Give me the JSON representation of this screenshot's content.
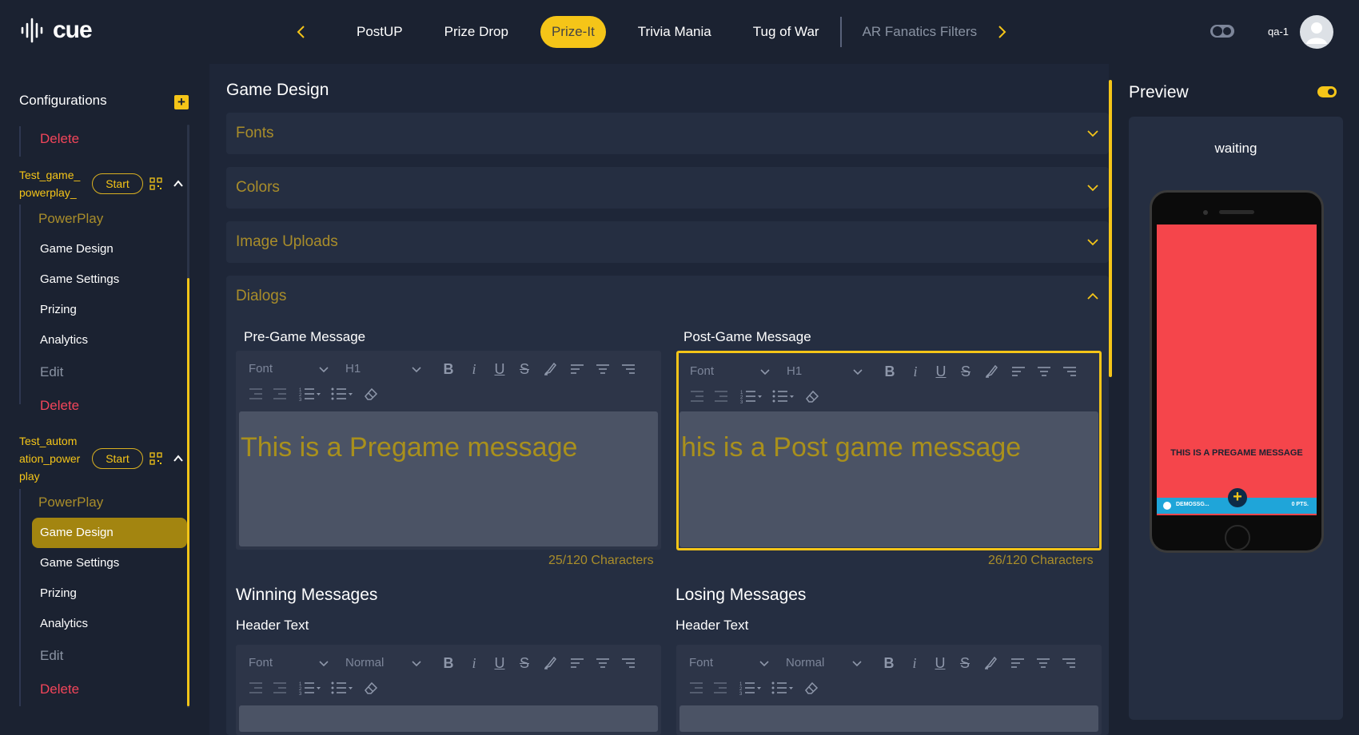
{
  "brand": {
    "name": "cue"
  },
  "top_tabs": [
    {
      "label": "PostUP",
      "active": false
    },
    {
      "label": "Prize Drop",
      "active": false
    },
    {
      "label": "Prize-It",
      "active": true
    },
    {
      "label": "Trivia Mania",
      "active": false
    },
    {
      "label": "Tug of War",
      "active": false
    },
    {
      "label": "AR Fanatics Filters",
      "active": false
    }
  ],
  "user": {
    "name": "qa-1"
  },
  "sidebar": {
    "title": "Configurations",
    "top_delete": "Delete",
    "configs": [
      {
        "name_lines": [
          "Test_game_",
          "powerplay_"
        ],
        "start_label": "Start",
        "type": "PowerPlay",
        "items": [
          "Game Design",
          "Game Settings",
          "Prizing",
          "Analytics"
        ],
        "edit": "Edit",
        "delete": "Delete"
      },
      {
        "name_lines": [
          "Test_autom",
          "ation_power",
          "play"
        ],
        "start_label": "Start",
        "type": "PowerPlay",
        "items": [
          "Game Design",
          "Game Settings",
          "Prizing",
          "Analytics"
        ],
        "edit": "Edit",
        "delete": "Delete",
        "selected_item": "Game Design"
      }
    ]
  },
  "main": {
    "title": "Game Design",
    "accordions": [
      {
        "label": "Fonts",
        "expanded": false
      },
      {
        "label": "Colors",
        "expanded": false
      },
      {
        "label": "Image Uploads",
        "expanded": false
      },
      {
        "label": "Dialogs",
        "expanded": true
      }
    ],
    "dialogs": {
      "pre_game": {
        "label": "Pre-Game Message",
        "font_placeholder": "Font",
        "heading": "H1",
        "content": "This is a Pregame message",
        "count": "25/120 Characters"
      },
      "post_game": {
        "label": "Post-Game Message",
        "font_placeholder": "Font",
        "heading": "H1",
        "content": "his is a Post game message",
        "count": "26/120 Characters"
      },
      "winning": {
        "title": "Winning Messages",
        "header_label": "Header Text",
        "font_placeholder": "Font",
        "heading": "Normal"
      },
      "losing": {
        "title": "Losing Messages",
        "header_label": "Header Text",
        "font_placeholder": "Font",
        "heading": "Normal"
      }
    }
  },
  "preview": {
    "title": "Preview",
    "status": "waiting",
    "phone_message": "This is a Pregame message",
    "phone_id": "DEMOSSG...",
    "phone_points": "0 PTS."
  },
  "colors": {
    "accent": "#f5c518",
    "danger": "#f2455a",
    "background": "#1b2231",
    "panel": "#252e41",
    "phone_screen": "#f5454b",
    "phone_bar": "#1fa5d9"
  }
}
